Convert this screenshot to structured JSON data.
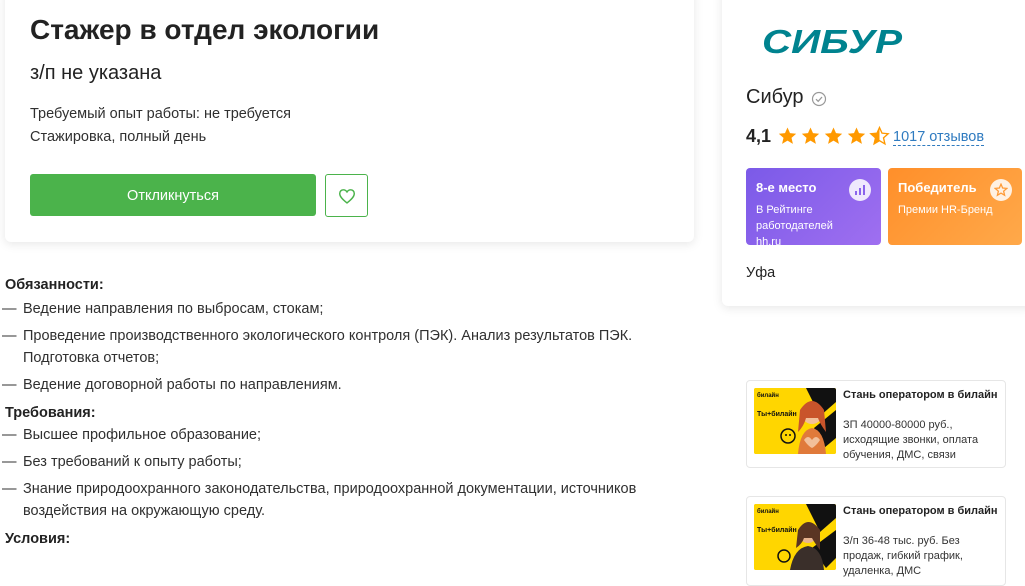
{
  "vacancy": {
    "title": "Стажер в отдел экологии",
    "salary": "з/п не указана",
    "experience": "Требуемый опыт работы: не требуется",
    "employment": "Стажировка, полный день",
    "respond_label": "Откликнуться"
  },
  "description": {
    "duties_title": "Обязанности:",
    "duties": [
      "Ведение направления по выбросам, стокам;",
      "Проведение производственного экологического контроля (ПЭК). Анализ результатов ПЭК. Подготовка отчетов;",
      "Ведение договорной работы по направлениям."
    ],
    "requirements_title": "Требования:",
    "requirements": [
      "Высшее профильное образование;",
      "Без требований к опыту работы;",
      "Знание природоохранного законодательства, природоохранной документации, источников воздействия на окружающую среду."
    ],
    "conditions_title": "Условия:",
    "dash": "—"
  },
  "company": {
    "logo_text": "СИБУР",
    "name": "Сибур",
    "rating": "4,1",
    "stars_filled": 4.5,
    "reviews": "1017 отзывов",
    "badge_rank_title": "8-е место",
    "badge_rank_text": "В Рейтинге работодателей hh.ru",
    "badge_award_title": "Победитель",
    "badge_award_text": "Премии HR-Бренд",
    "city": "Уфа",
    "logo_color": "#00838f"
  },
  "ads": [
    {
      "brand": "билайн",
      "tagline": "Ты+билайн",
      "title": "Стань оператором в билайн",
      "text": "ЗП 40000-80000 руб., исходящие звонки, оплата обучения, ДМС, связи"
    },
    {
      "brand": "билайн",
      "tagline": "Ты+билайн",
      "title": "Стань оператором в билайн",
      "text": "З/п 36-48 тыс. руб. Без продаж, гибкий график, удаленка, ДМС"
    }
  ],
  "colors": {
    "accent_green": "#4bb34b",
    "link_blue": "#2f7bc0",
    "star_orange": "#ff9900",
    "badge_purple": "#8a63ec",
    "badge_orange": "#ff9a35"
  }
}
